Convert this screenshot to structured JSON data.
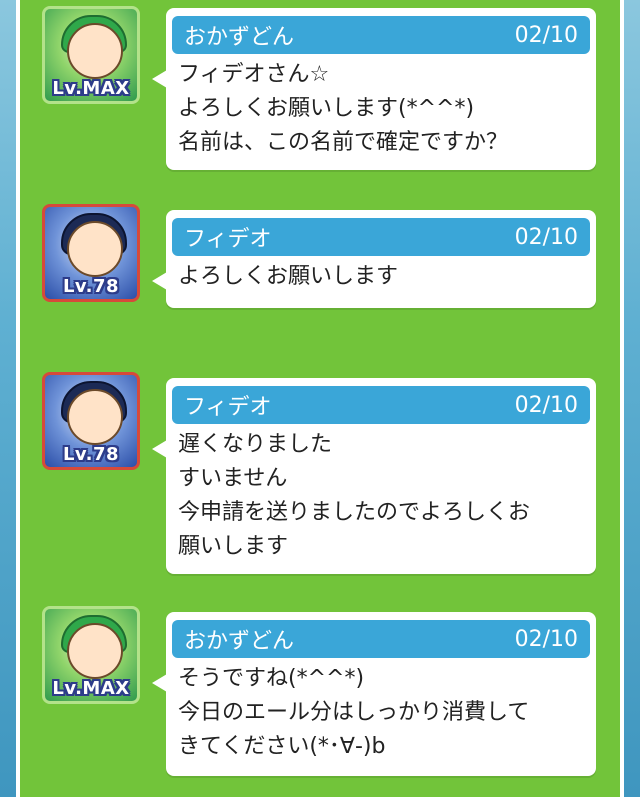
{
  "messages": [
    {
      "sender": "おかずどん",
      "date": "02/10",
      "level": "Lv.MAX",
      "avatar": "green-hair-character",
      "lines": [
        "フィデオさん☆",
        "よろしくお願いします(*^^*)",
        "名前は、この名前で確定ですか？"
      ]
    },
    {
      "sender": "フィデオ",
      "date": "02/10",
      "level": "Lv.78",
      "avatar": "blue-hair-character",
      "lines": [
        "よろしくお願いします"
      ]
    },
    {
      "sender": "フィデオ",
      "date": "02/10",
      "level": "Lv.78",
      "avatar": "blue-hair-character",
      "lines": [
        "遅くなりました",
        "すいません",
        "今申請を送りましたのでよろしくお",
        "願いします"
      ]
    },
    {
      "sender": "おかずどん",
      "date": "02/10",
      "level": "Lv.MAX",
      "avatar": "green-hair-character",
      "lines": [
        "そうですね(*^^*)",
        "今日のエール分はしっかり消費して",
        "きてください(*･∀-)b"
      ]
    }
  ],
  "colors": {
    "panel": "#72c43a",
    "header": "#3aa6d8",
    "bubble": "#ffffff"
  }
}
